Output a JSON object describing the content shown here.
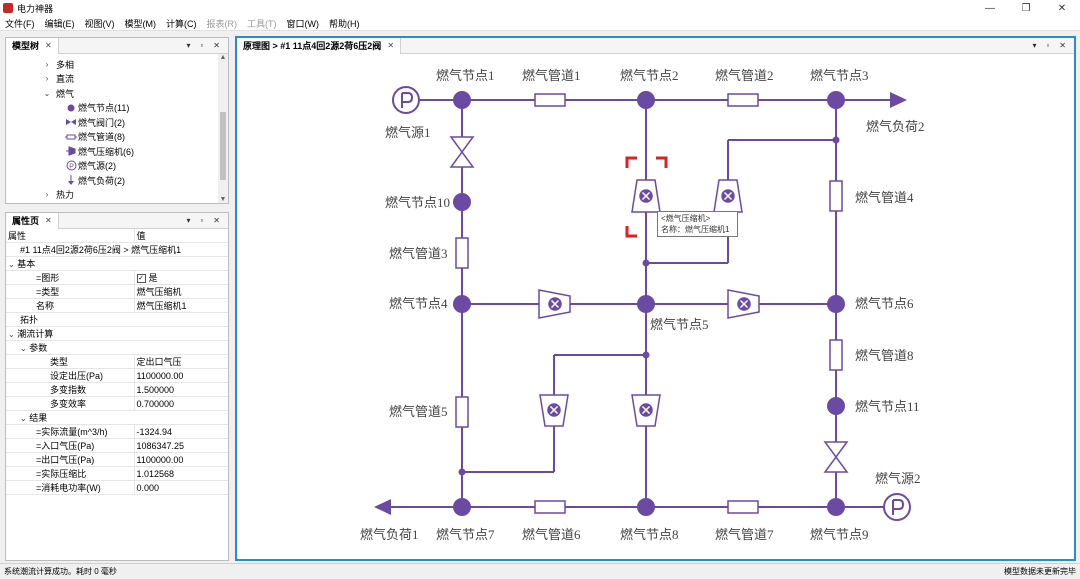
{
  "window": {
    "title": "电力神器",
    "btn_min": "—",
    "btn_max": "❐",
    "btn_close": "✕"
  },
  "menu": [
    {
      "label": "文件(F)",
      "enabled": true
    },
    {
      "label": "编辑(E)",
      "enabled": true
    },
    {
      "label": "视图(V)",
      "enabled": true
    },
    {
      "label": "模型(M)",
      "enabled": true
    },
    {
      "label": "计算(C)",
      "enabled": true
    },
    {
      "label": "报表(R)",
      "enabled": false
    },
    {
      "label": "工具(T)",
      "enabled": false
    },
    {
      "label": "窗口(W)",
      "enabled": true
    },
    {
      "label": "帮助(H)",
      "enabled": true
    }
  ],
  "model_tree": {
    "tab_label": "模型树",
    "items": [
      {
        "label": "多相",
        "chev": "›"
      },
      {
        "label": "直流",
        "chev": "›"
      },
      {
        "label": "燃气",
        "chev": "⌄"
      },
      {
        "label": "燃气节点(11)",
        "icon": "dot-icon"
      },
      {
        "label": "燃气阀门(2)",
        "icon": "valve-icon"
      },
      {
        "label": "燃气管道(8)",
        "icon": "pipe-icon"
      },
      {
        "label": "燃气压缩机(6)",
        "icon": "compressor-icon"
      },
      {
        "label": "燃气源(2)",
        "icon": "source-icon"
      },
      {
        "label": "燃气负荷(2)",
        "icon": "load-icon"
      },
      {
        "label": "热力",
        "chev": "›"
      }
    ]
  },
  "properties": {
    "tab_label": "属性页",
    "col_attr": "属性",
    "col_value": "值",
    "path": "#1 11点4回2源2荷6压2阀 > 燃气压缩机1",
    "rows": [
      {
        "type": "section",
        "label": "基本"
      },
      {
        "type": "row",
        "label": "=图形",
        "value": "是",
        "checkbox": true
      },
      {
        "type": "row",
        "label": "=类型",
        "value": "燃气压缩机"
      },
      {
        "type": "row",
        "label": "名称",
        "value": "燃气压缩机1"
      },
      {
        "type": "plain",
        "label": "拓扑"
      },
      {
        "type": "section",
        "label": "潮流计算"
      },
      {
        "type": "subsection",
        "label": "参数"
      },
      {
        "type": "row2",
        "label": "类型",
        "value": "定出口气压"
      },
      {
        "type": "row2",
        "label": "设定出压(Pa)",
        "value": "1100000.00"
      },
      {
        "type": "row2",
        "label": "多变指数",
        "value": "1.500000"
      },
      {
        "type": "row2",
        "label": "多变效率",
        "value": "0.700000"
      },
      {
        "type": "subsection",
        "label": "结果"
      },
      {
        "type": "row2",
        "label": "=实际流量(m^3/h)",
        "value": "-1324.94"
      },
      {
        "type": "row2",
        "label": "=入口气压(Pa)",
        "value": "1086347.25"
      },
      {
        "type": "row2",
        "label": "=出口气压(Pa)",
        "value": "1100000.00"
      },
      {
        "type": "row2",
        "label": "=实际压缩比",
        "value": "1.012568"
      },
      {
        "type": "row2",
        "label": "=消耗电功率(W)",
        "value": "0.000"
      }
    ]
  },
  "diagram": {
    "tab_label": "原理图 > #1 11点4回2源2荷6压2阀",
    "accent": "#6b4aa3",
    "selection_color": "#e02020",
    "labels": {
      "n1": "燃气节点1",
      "n2": "燃气节点2",
      "n3": "燃气节点3",
      "n4": "燃气节点4",
      "n5": "燃气节点5",
      "n6": "燃气节点6",
      "n7": "燃气节点7",
      "n8": "燃气节点8",
      "n9": "燃气节点9",
      "n10": "燃气节点10",
      "n11": "燃气节点11",
      "p1": "燃气管道1",
      "p2": "燃气管道2",
      "p3": "燃气管道3",
      "p4": "燃气管道4",
      "p5": "燃气管道5",
      "p6": "燃气管道6",
      "p7": "燃气管道7",
      "p8": "燃气管道8",
      "s1": "燃气源1",
      "s2": "燃气源2",
      "l1": "燃气负荷1",
      "l2": "燃气负荷2"
    },
    "tooltip": {
      "line1": "<燃气压缩机>",
      "line2": "名称：燃气压缩机1"
    }
  },
  "status": {
    "left": "系统潮流计算成功。耗时 0 毫秒",
    "right": "模型数据未更新完毕"
  }
}
